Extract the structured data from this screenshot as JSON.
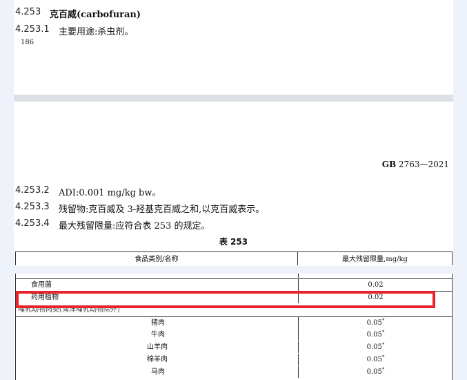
{
  "section_top": {
    "title_num": "4.253",
    "title_text": "克百威(carbofuran)",
    "sub1_num": "4.253.1",
    "sub1_text": "主要用途:杀虫剂。",
    "page_number": "186"
  },
  "standard": {
    "prefix": "GB",
    "code": "2763—2021"
  },
  "section_bottom": {
    "sub2_num": "4.253.2",
    "sub2_text": "ADI:0.001 mg/kg bw。",
    "sub3_num": "4.253.3",
    "sub3_text": "残留物:克百威及 3-羟基克百威之和,以克百威表示。",
    "sub4_num": "4.253.4",
    "sub4_text": "最大残留限量:应符合表 253 的规定。"
  },
  "table": {
    "title": "表 253",
    "col1_header": "食品类别/名称",
    "col2_header": "最大残留限量,mg/kg",
    "cut_row_text": "",
    "cut_row_value": "",
    "rows": [
      {
        "name": "食用菌",
        "value": "0.02"
      },
      {
        "name": "药用植物",
        "value": "0.02"
      }
    ],
    "partial_heading": "哺乳动物肉类(海洋哺乳动物除外)",
    "meat_rows": [
      {
        "name": "猪肉",
        "value": "0.05",
        "mark": "*"
      },
      {
        "name": "牛肉",
        "value": "0.05",
        "mark": "*"
      },
      {
        "name": "山羊肉",
        "value": "0.05",
        "mark": "*"
      },
      {
        "name": "绵羊肉",
        "value": "0.05",
        "mark": "*"
      },
      {
        "name": "马肉",
        "value": "0.05",
        "mark": "*"
      }
    ]
  }
}
